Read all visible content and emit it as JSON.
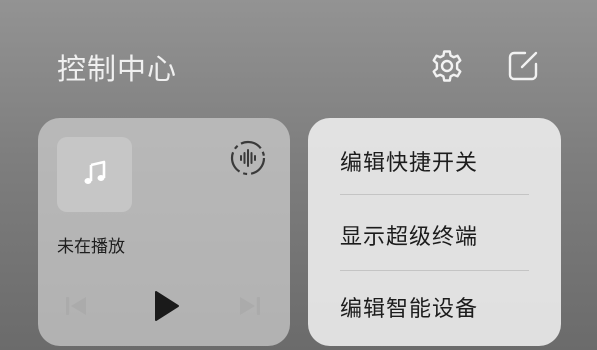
{
  "header": {
    "title": "控制中心",
    "icons": {
      "settings": "gear-icon",
      "edit": "edit-square-icon"
    }
  },
  "media": {
    "status": "未在播放",
    "album_icon": "music-note-icon",
    "output_icon": "audio-output-icon",
    "controls": [
      "previous-icon",
      "play-icon",
      "next-icon"
    ]
  },
  "menu": {
    "items": [
      {
        "label": "编辑快捷开关"
      },
      {
        "label": "显示超级终端"
      },
      {
        "label": "编辑智能设备"
      }
    ]
  },
  "colors": {
    "background": "#808080",
    "menu_bg": "#e8e8e8",
    "media_card_bg": "#cdcdcd",
    "text_light": "#f0f0f0",
    "text_dark": "#1c1c1c"
  }
}
